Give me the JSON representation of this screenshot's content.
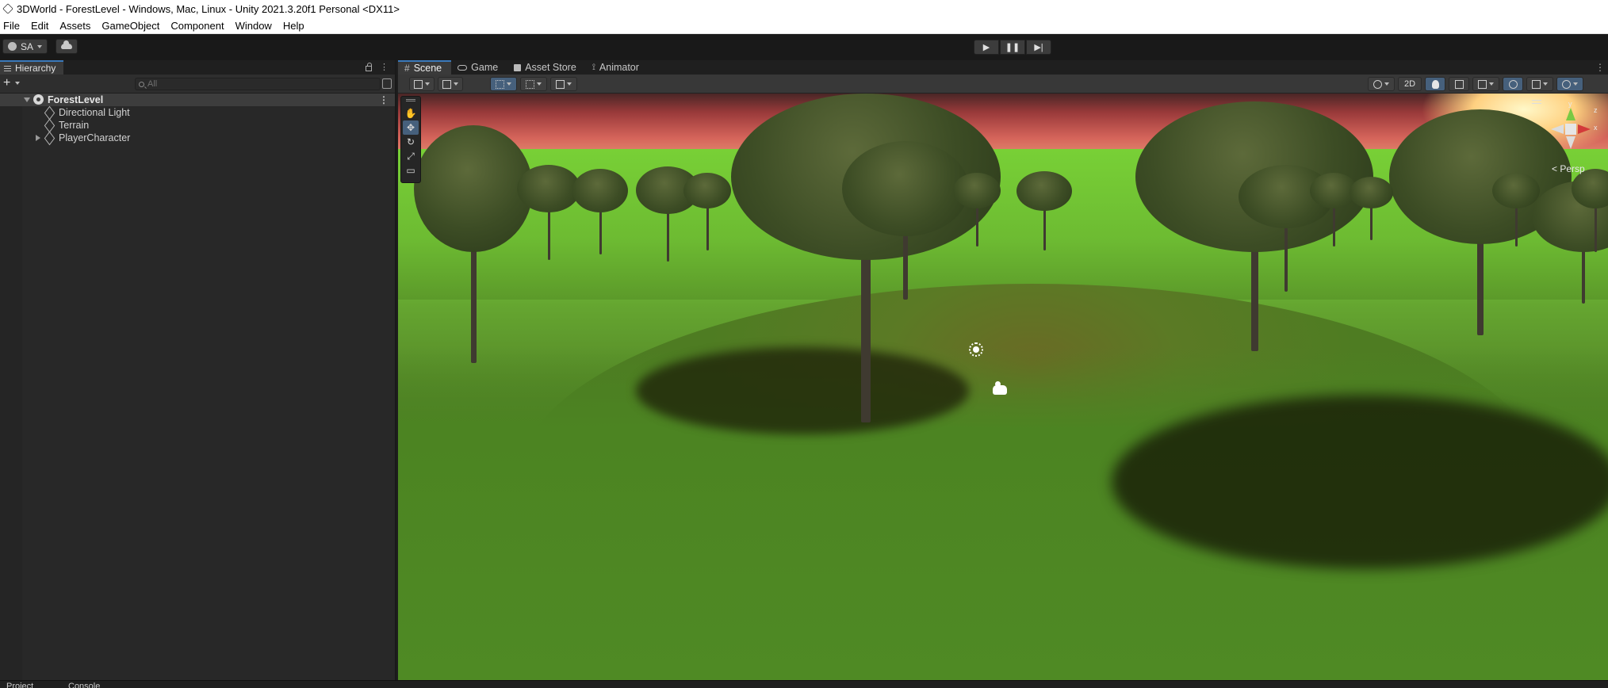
{
  "window": {
    "title": "3DWorld - ForestLevel - Windows, Mac, Linux - Unity 2021.3.20f1 Personal <DX11>"
  },
  "menu": {
    "items": [
      "File",
      "Edit",
      "Assets",
      "GameObject",
      "Component",
      "Window",
      "Help"
    ]
  },
  "toolbar": {
    "account_label": "SA",
    "cloud_icon": "cloud-icon",
    "play_icon": "▶",
    "pause_icon": "❚❚",
    "step_icon": "▶|"
  },
  "hierarchy": {
    "tab_label": "Hierarchy",
    "add_label": "+",
    "search_placeholder": "All",
    "scene_name": "ForestLevel",
    "items": [
      {
        "label": "Directional Light",
        "has_children": false
      },
      {
        "label": "Terrain",
        "has_children": false
      },
      {
        "label": "PlayerCharacter",
        "has_children": true
      }
    ],
    "more_icon": "⋮"
  },
  "scene_view": {
    "tabs": [
      {
        "label": "Scene",
        "icon": "hash-icon",
        "active": true
      },
      {
        "label": "Game",
        "icon": "game-icon",
        "active": false
      },
      {
        "label": "Asset Store",
        "icon": "asset-store-icon",
        "active": false
      },
      {
        "label": "Animator",
        "icon": "animator-icon",
        "active": false
      }
    ],
    "toggle_2d_label": "2D",
    "projection_label": "< Persp",
    "gizmo_axes": {
      "x": "x",
      "y": "y",
      "z": "z"
    },
    "accent_color": "#3a79bb",
    "active_tool": "move-tool"
  },
  "bottom_dock": {
    "tabs": [
      "Project",
      "Console"
    ]
  }
}
